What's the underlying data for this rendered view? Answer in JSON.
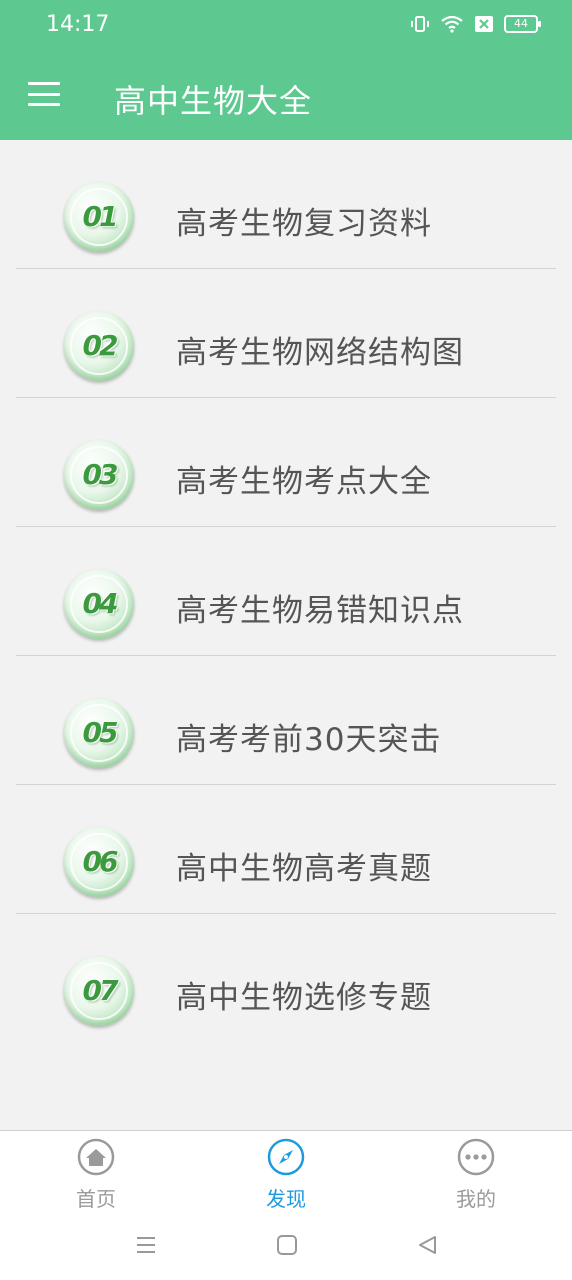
{
  "status_bar": {
    "time": "14:17",
    "battery": "44",
    "icons": [
      "vibrate-icon",
      "wifi-icon",
      "sim-off-icon",
      "battery-icon"
    ]
  },
  "toolbar": {
    "menu_icon": "hamburger-menu-icon",
    "title": "高中生物大全"
  },
  "list": {
    "items": [
      {
        "number": "01",
        "label": "高考生物复习资料"
      },
      {
        "number": "02",
        "label": "高考生物网络结构图"
      },
      {
        "number": "03",
        "label": "高考生物考点大全"
      },
      {
        "number": "04",
        "label": "高考生物易错知识点"
      },
      {
        "number": "05",
        "label": "高考考前30天突击"
      },
      {
        "number": "06",
        "label": "高中生物高考真题"
      },
      {
        "number": "07",
        "label": "高中生物选修专题"
      }
    ]
  },
  "bottom_nav": {
    "items": [
      {
        "label": "首页",
        "icon": "home-icon",
        "active": false
      },
      {
        "label": "发现",
        "icon": "compass-icon",
        "active": true
      },
      {
        "label": "我的",
        "icon": "more-dots-icon",
        "active": false
      }
    ]
  },
  "colors": {
    "header": "#5dc88f",
    "nav_active": "#1e9be0",
    "nav_inactive": "#9a9a9a",
    "badge_green": "#3a9a3d"
  }
}
